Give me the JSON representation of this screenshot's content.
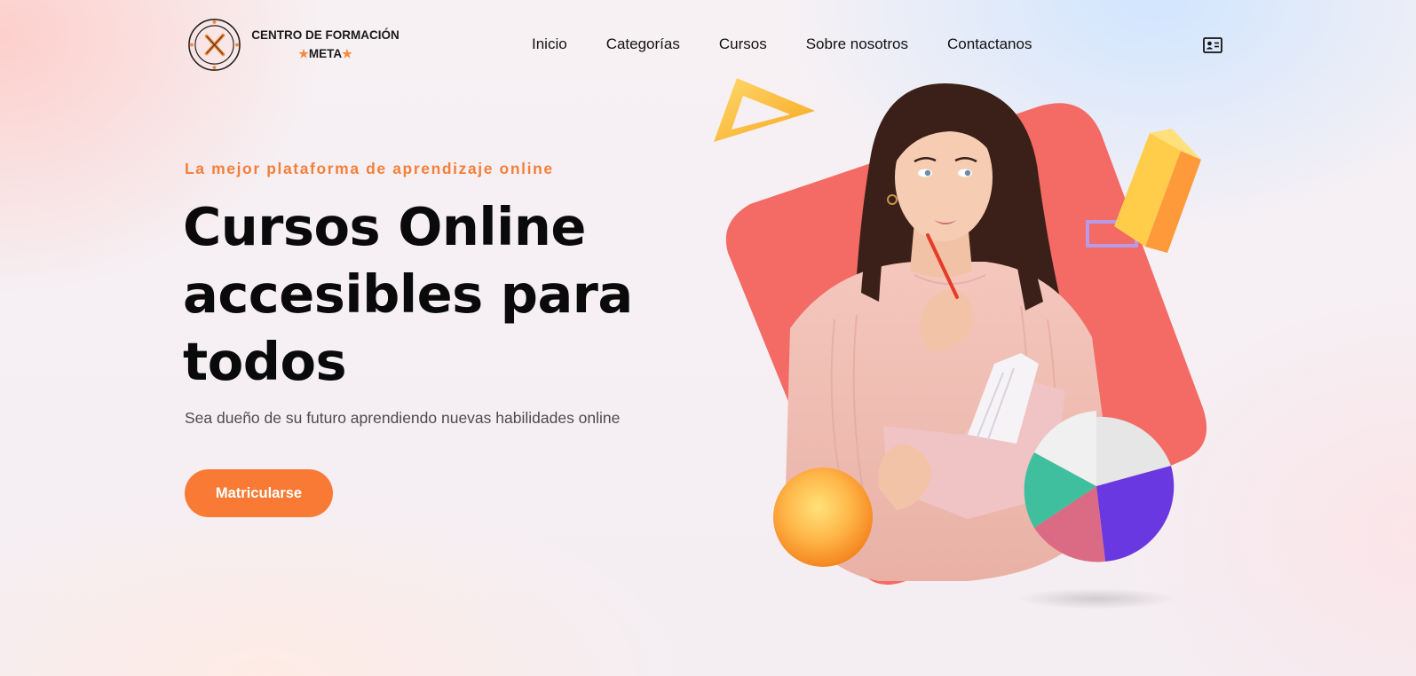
{
  "header": {
    "logo": {
      "line1": "CENTRO DE FORMACIÓN",
      "line2": "META",
      "star": "★"
    },
    "nav": [
      {
        "label": "Inicio"
      },
      {
        "label": "Categorías"
      },
      {
        "label": "Cursos"
      },
      {
        "label": "Sobre nosotros"
      },
      {
        "label": "Contactanos"
      }
    ],
    "contact_icon": "contact-card-icon"
  },
  "hero": {
    "eyebrow": "La mejor plataforma de aprendizaje online",
    "headline_lines": [
      "Cursos Online",
      "accesibles para",
      "todos"
    ],
    "subtitle": "Sea dueño de su futuro aprendiendo nuevas habilidades online",
    "cta_label": "Matricularse"
  },
  "colors": {
    "accent": "#f97a34",
    "coral_shape": "#f46a64",
    "text_dark": "#0a0a0a",
    "pie_teal": "#3fbf9e",
    "pie_purple": "#6a38e0",
    "pie_pink": "#db6b85",
    "pie_grey": "#e6e6e6"
  }
}
